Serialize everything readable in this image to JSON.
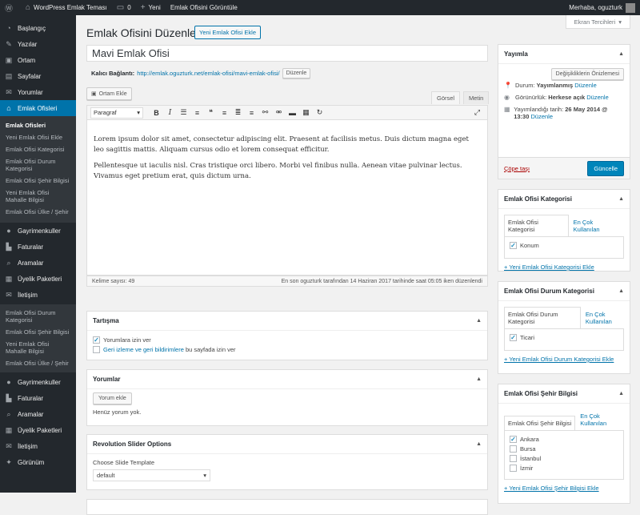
{
  "adminbar": {
    "site_name": "WordPress Emlak Teması",
    "comments_count": "0",
    "new_label": "Yeni",
    "view_label": "Emlak Ofisini Görüntüle",
    "greeting": "Merhaba, oguzturk"
  },
  "sidebar": {
    "items_top": [
      {
        "icon": "dashboard-icon",
        "glyph": "◔",
        "label": "Başlangıç"
      },
      {
        "icon": "pin-icon",
        "glyph": "✎",
        "label": "Yazılar"
      },
      {
        "icon": "media-icon",
        "glyph": "▣",
        "label": "Ortam"
      },
      {
        "icon": "pages-icon",
        "glyph": "▤",
        "label": "Sayfalar"
      },
      {
        "icon": "comments-icon",
        "glyph": "✉",
        "label": "Yorumlar"
      }
    ],
    "current": {
      "icon": "building-icon",
      "glyph": "⌂",
      "label": "Emlak Ofisleri"
    },
    "submenu": [
      "Emlak Ofisleri",
      "Yeni Emlak Ofisi Ekle",
      "Emlak Ofisi Kategorisi",
      "Emlak Ofisi Durum Kategorisi",
      "Emlak Ofisi Şehir Bilgisi",
      "Yeni Emlak Ofisi Mahalle Bilgisi",
      "Emlak Ofisi Ülke / Şehir"
    ],
    "items_mid": [
      {
        "icon": "location-icon",
        "glyph": "●",
        "label": "Gayrimenkuller"
      },
      {
        "icon": "invoice-icon",
        "glyph": "▙",
        "label": "Faturalar"
      },
      {
        "icon": "search-icon",
        "glyph": "⌕",
        "label": "Aramalar"
      },
      {
        "icon": "package-icon",
        "glyph": "▦",
        "label": "Üyelik Paketleri"
      },
      {
        "icon": "mail-icon",
        "glyph": "✉",
        "label": "İletişim"
      }
    ],
    "flyout": [
      "Emlak Ofisi Durum Kategorisi",
      "Emlak Ofisi Şehir Bilgisi",
      "Yeni Emlak Ofisi Mahalle Bilgisi",
      "Emlak Ofisi Ülke / Şehir"
    ],
    "items_bottom": [
      {
        "icon": "location-icon",
        "glyph": "●",
        "label": "Gayrimenkuller"
      },
      {
        "icon": "invoice-icon",
        "glyph": "▙",
        "label": "Faturalar"
      },
      {
        "icon": "search-icon",
        "glyph": "⌕",
        "label": "Aramalar"
      },
      {
        "icon": "package-icon",
        "glyph": "▦",
        "label": "Üyelik Paketleri"
      },
      {
        "icon": "mail-icon",
        "glyph": "✉",
        "label": "İletişim"
      },
      {
        "icon": "appearance-icon",
        "glyph": "✦",
        "label": "Görünüm"
      }
    ]
  },
  "header": {
    "screen_options": "Ekran Tercihleri",
    "title": "Emlak Ofisini Düzenle",
    "add_new": "Yeni Emlak Ofisi Ekle"
  },
  "post": {
    "title_value": "Mavi Emlak Ofisi",
    "permalink_label": "Kalıcı Bağlantı:",
    "permalink_url": "http://emlak.oguzturk.net/emlak-ofisi/mavi-emlak-ofisi/",
    "edit_label": "Düzenle"
  },
  "editor": {
    "add_media": "Ortam Ekle",
    "tab_visual": "Görsel",
    "tab_text": "Metin",
    "format": "Paragraf",
    "paragraphs": [
      "Lorem ipsum dolor sit amet, consectetur adipiscing elit. Praesent at facilisis metus. Duis dictum magna eget leo sagittis mattis. Aliquam cursus odio et lorem consequat efficitur.",
      "Pellentesque ut iaculis nisl. Cras tristique orci libero. Morbi vel finibus nulla. Aenean vitae pulvinar lectus. Vivamus eget pretium erat, quis dictum urna."
    ],
    "word_count": "Kelime sayısı: 49",
    "last_edited": "En son oguzturk tarafından 14 Haziran 2017 tarihinde saat 05:05 iken düzenlendi"
  },
  "discussion": {
    "title": "Tartışma",
    "allow_comments": "Yorumlara izin ver",
    "trackbacks_link": "Geri izleme ve geri bildirimlere",
    "trackbacks_rest": " bu sayfada izin ver"
  },
  "comments": {
    "title": "Yorumlar",
    "add_button": "Yorum ekle",
    "none": "Henüz yorum yok."
  },
  "revslider": {
    "title": "Revolution Slider Options",
    "choose_label": "Choose Slide Template",
    "selected": "default"
  },
  "publish": {
    "title": "Yayımla",
    "preview": "Değişikliklerin Önizlemesi",
    "status_label": "Durum: ",
    "status_value": "Yayımlanmış",
    "visibility_label": "Görünürlük: ",
    "visibility_value": "Herkese açık",
    "date_label": "Yayımlandığı tarih: ",
    "date_value": "26 May 2014 @ 13:30",
    "edit": "Düzenle",
    "trash": "Çöpe taşı",
    "update": "Güncelle"
  },
  "category_box": {
    "title": "Emlak Ofisi Kategorisi",
    "tab_all": "Emlak Ofisi Kategorisi",
    "tab_popular": "En Çok Kullanılan",
    "items": [
      {
        "label": "Konum",
        "checked": true
      }
    ],
    "add_link": "+ Yeni Emlak Ofisi Kategorisi Ekle"
  },
  "status_box": {
    "title": "Emlak Ofisi Durum Kategorisi",
    "tab_all": "Emlak Ofisi Durum Kategorisi",
    "tab_popular": "En Çok Kullanılan",
    "items": [
      {
        "label": "Ticari",
        "checked": true
      }
    ],
    "add_link": "+ Yeni Emlak Ofisi Durum Kategorisi Ekle"
  },
  "city_box": {
    "title": "Emlak Ofisi Şehir Bilgisi",
    "tab_all": "Emlak Ofisi Şehir Bilgisi",
    "tab_popular": "En Çok Kullanılan",
    "items": [
      {
        "label": "Ankara",
        "checked": true
      },
      {
        "label": "Bursa",
        "checked": false
      },
      {
        "label": "İstanbul",
        "checked": false
      },
      {
        "label": "İzmir",
        "checked": false
      }
    ],
    "add_link": "+ Yeni Emlak Ofisi Şehir Bilgisi Ekle"
  }
}
